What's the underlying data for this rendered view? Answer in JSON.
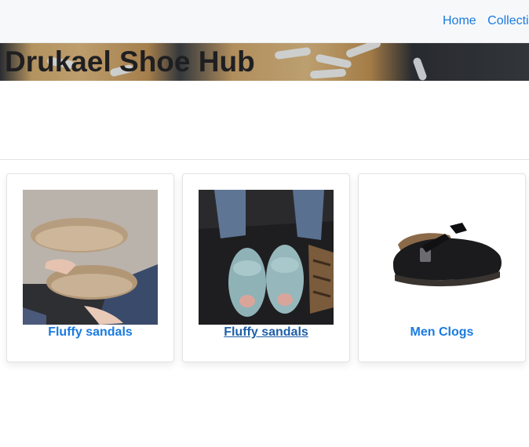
{
  "nav": {
    "links": [
      "Home",
      "Collecti"
    ]
  },
  "hero": {
    "title": "Drukael Shoe Hub"
  },
  "products": [
    {
      "name": "Fluffy sandals",
      "image": "beige-fluffy-sandals-photo"
    },
    {
      "name": "Fluffy sandals",
      "image": "blue-fluffy-sandals-photo"
    },
    {
      "name": "Men Clogs",
      "image": "black-clogs-photo"
    }
  ],
  "colors": {
    "link": "#1a7be0",
    "link_hover": "#1f5fa8",
    "navbar_bg": "#f7f8fa"
  }
}
